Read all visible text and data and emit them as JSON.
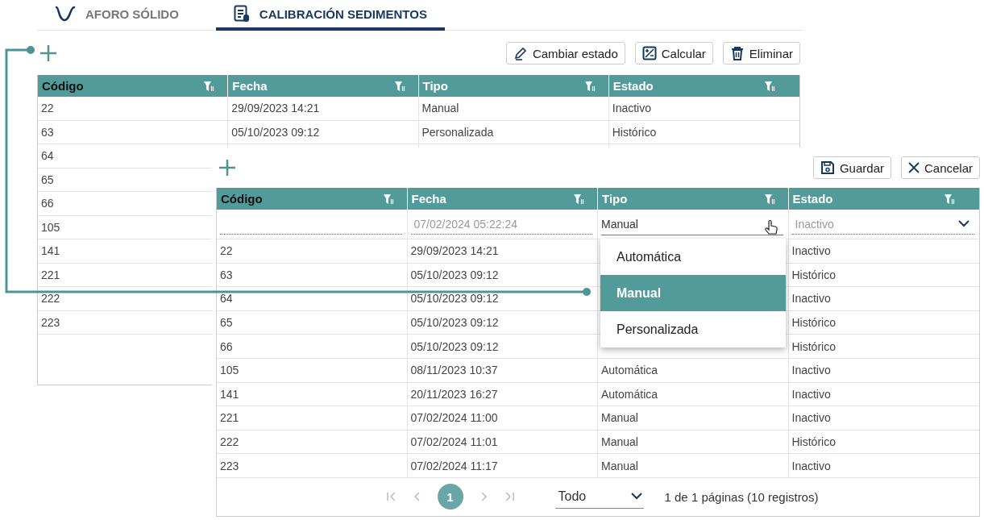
{
  "tabs": [
    {
      "label": "AFORO SÓLIDO",
      "selected": false,
      "kind": "wave"
    },
    {
      "label": "CALIBRACIÓN SEDIMENTOS",
      "selected": true,
      "kind": "doc"
    }
  ],
  "background_panel": {
    "buttons": [
      {
        "label": "Cambiar estado",
        "kind": "edit"
      },
      {
        "label": "Calcular",
        "kind": "calc"
      },
      {
        "label": "Eliminar",
        "kind": "delete"
      }
    ],
    "table": {
      "columns": [
        "Código",
        "Fecha",
        "Tipo",
        "Estado"
      ],
      "rows": [
        {
          "codigo": "22",
          "fecha": "29/09/2023 14:21",
          "tipo": "Manual",
          "estado": "Inactivo"
        },
        {
          "codigo": "63",
          "fecha": "05/10/2023 09:12",
          "tipo": "Personalizada",
          "estado": "Histórico"
        },
        {
          "codigo": "64"
        },
        {
          "codigo": "65"
        },
        {
          "codigo": "66"
        },
        {
          "codigo": "105"
        },
        {
          "codigo": "141"
        },
        {
          "codigo": "221"
        },
        {
          "codigo": "222"
        },
        {
          "codigo": "223"
        }
      ]
    }
  },
  "edit_panel": {
    "buttons": [
      {
        "label": "Guardar",
        "kind": "save"
      },
      {
        "label": "Cancelar",
        "kind": "cancel"
      }
    ],
    "table": {
      "columns": [
        "Código",
        "Fecha",
        "Tipo",
        "Estado"
      ],
      "edit_row": {
        "fecha": {
          "value": "07/02/2024 05:22:24",
          "disabled": true
        },
        "tipo": {
          "value": "Manual",
          "disabled": false
        },
        "estado": {
          "value": "Inactivo",
          "disabled": true
        }
      },
      "rows": [
        {
          "codigo": "22",
          "fecha": "29/09/2023 14:21",
          "estado": "Inactivo"
        },
        {
          "codigo": "63",
          "fecha": "05/10/2023 09:12",
          "estado": "Histórico"
        },
        {
          "codigo": "64",
          "fecha": "05/10/2023 09:12",
          "estado": "Inactivo"
        },
        {
          "codigo": "65",
          "fecha": "05/10/2023 09:12",
          "estado": "Histórico"
        },
        {
          "codigo": "66",
          "fecha": "05/10/2023 09:12",
          "estado": "Histórico"
        },
        {
          "codigo": "105",
          "fecha": "08/11/2023 10:37",
          "tipo": "Automática",
          "estado": "Inactivo"
        },
        {
          "codigo": "141",
          "fecha": "20/11/2023 16:27",
          "tipo": "Automática",
          "estado": "Inactivo"
        },
        {
          "codigo": "221",
          "fecha": "07/02/2024 11:00",
          "tipo": "Manual",
          "estado": "Inactivo"
        },
        {
          "codigo": "222",
          "fecha": "07/02/2024 11:01",
          "tipo": "Manual",
          "estado": "Histórico"
        },
        {
          "codigo": "223",
          "fecha": "07/02/2024 11:17",
          "tipo": "Manual",
          "estado": "Inactivo"
        }
      ]
    },
    "dropdown": {
      "options": [
        {
          "label": "Automática",
          "selected": false
        },
        {
          "label": "Manual",
          "selected": true
        },
        {
          "label": "Personalizada",
          "selected": false
        }
      ]
    },
    "pager": {
      "page": "1",
      "page_size": "Todo",
      "summary": "1 de 1 páginas (10 registros)"
    }
  }
}
